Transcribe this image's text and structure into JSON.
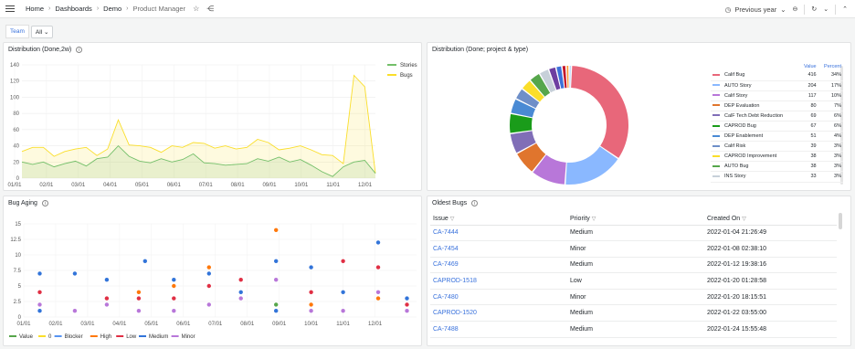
{
  "breadcrumb": [
    "Home",
    "Dashboards",
    "Demo",
    "Product Manager"
  ],
  "time_range": "Previous year",
  "variable": {
    "label": "Team",
    "value": "All"
  },
  "panels": {
    "dist": "Distribution (Done,2w)",
    "donut": "Distribution (Done; project & type)",
    "aging": "Bug Aging",
    "oldest": "Oldest Bugs"
  },
  "icons": [
    "menu-icon",
    "star-icon",
    "share-icon",
    "clock-icon",
    "chevron-down-icon",
    "zoom-out-icon",
    "refresh-icon",
    "chevron-down-icon",
    "info-icon",
    "filter-icon"
  ],
  "colors": {
    "stories": "#73bf69",
    "bugs": "#fade2a",
    "link": "#3871dc"
  },
  "chart_data": [
    {
      "type": "area",
      "title": "Distribution (Done,2w)",
      "x_ticks": [
        "01/01",
        "02/01",
        "03/01",
        "04/01",
        "05/01",
        "06/01",
        "07/01",
        "08/01",
        "09/01",
        "10/01",
        "11/01",
        "12/01"
      ],
      "ylim": [
        0,
        140
      ],
      "y_ticks": [
        0,
        20,
        40,
        60,
        80,
        100,
        120,
        140
      ],
      "legend": "top-right",
      "series": [
        {
          "name": "Stories",
          "color": "#73bf69",
          "values": [
            20,
            17,
            20,
            14,
            18,
            21,
            15,
            24,
            26,
            40,
            27,
            21,
            19,
            24,
            20,
            23,
            30,
            19,
            18,
            16,
            17,
            18,
            24,
            21,
            26,
            20,
            23,
            16,
            8,
            2,
            14,
            20,
            22,
            6
          ]
        },
        {
          "name": "Bugs",
          "color": "#fade2a",
          "values": [
            33,
            38,
            38,
            27,
            33,
            36,
            38,
            28,
            36,
            72,
            41,
            40,
            38,
            32,
            40,
            38,
            44,
            43,
            37,
            40,
            36,
            38,
            48,
            44,
            35,
            37,
            40,
            35,
            29,
            28,
            18,
            127,
            113,
            6
          ]
        }
      ]
    },
    {
      "type": "pie",
      "title": "Distribution (Done; project & type)",
      "columns": [
        "Value",
        "Percent"
      ],
      "slices": [
        {
          "label": "Calif Bug",
          "value": 416,
          "percent": "34%",
          "color": "#e8677a"
        },
        {
          "label": "AUTO Story",
          "value": 204,
          "percent": "17%",
          "color": "#8ab8ff"
        },
        {
          "label": "Calif Story",
          "value": 117,
          "percent": "10%",
          "color": "#b877d9"
        },
        {
          "label": "DEP Evaluation",
          "value": 80,
          "percent": "7%",
          "color": "#e0752d"
        },
        {
          "label": "CalF Tech Debt Reduction",
          "value": 69,
          "percent": "6%",
          "color": "#806eb7"
        },
        {
          "label": "CAPROD Bug",
          "value": 67,
          "percent": "6%",
          "color": "#1a9c1a"
        },
        {
          "label": "DEP Enablement",
          "value": 51,
          "percent": "4%",
          "color": "#4a8ad4"
        },
        {
          "label": "Calif Risk",
          "value": 39,
          "percent": "3%",
          "color": "#6e8fc8"
        },
        {
          "label": "CAPROD Improvement",
          "value": 38,
          "percent": "3%",
          "color": "#fade2a"
        },
        {
          "label": "AUTO Bug",
          "value": 38,
          "percent": "3%",
          "color": "#56a64b"
        },
        {
          "label": "INS Story",
          "value": 33,
          "percent": "3%",
          "color": "#c7d0d9"
        }
      ],
      "extra_slices": [
        {
          "value": 25,
          "color": "#6e3fa0"
        },
        {
          "value": 20,
          "color": "#3d71d9"
        },
        {
          "value": 14,
          "color": "#c4162a"
        },
        {
          "value": 10,
          "color": "#ff9830"
        },
        {
          "value": 8,
          "color": "#a8d0ff"
        }
      ]
    },
    {
      "type": "scatter",
      "title": "Bug Aging",
      "x_ticks": [
        "01/01",
        "02/01",
        "03/01",
        "04/01",
        "05/01",
        "06/01",
        "07/01",
        "08/01",
        "09/01",
        "10/01",
        "11/01",
        "12/01"
      ],
      "ylim": [
        0,
        15
      ],
      "y_ticks": [
        0,
        2.5,
        5,
        7.5,
        10,
        12.5,
        15
      ],
      "legend": "bottom",
      "legend_items": [
        {
          "name": "Value",
          "color": "#56a64b"
        },
        {
          "name": "0",
          "color": "#fade2a"
        },
        {
          "name": "Blocker",
          "color": "#5794f2"
        },
        {
          "name": "High",
          "color": "#ff780a"
        },
        {
          "name": "Low",
          "color": "#e02f44"
        },
        {
          "name": "Medium",
          "color": "#3274d9"
        },
        {
          "name": "Minor",
          "color": "#b877d9"
        }
      ],
      "points": [
        {
          "x": 0.5,
          "y": 7,
          "c": "#3274d9"
        },
        {
          "x": 0.5,
          "y": 4,
          "c": "#e02f44"
        },
        {
          "x": 0.5,
          "y": 2,
          "c": "#b877d9"
        },
        {
          "x": 0.5,
          "y": 1,
          "c": "#3274d9"
        },
        {
          "x": 1.6,
          "y": 7,
          "c": "#3274d9"
        },
        {
          "x": 1.6,
          "y": 1,
          "c": "#b877d9"
        },
        {
          "x": 2.6,
          "y": 6,
          "c": "#3274d9"
        },
        {
          "x": 2.6,
          "y": 3,
          "c": "#e02f44"
        },
        {
          "x": 2.6,
          "y": 2,
          "c": "#b877d9"
        },
        {
          "x": 3.6,
          "y": 4,
          "c": "#ff780a"
        },
        {
          "x": 3.6,
          "y": 3,
          "c": "#e02f44"
        },
        {
          "x": 3.6,
          "y": 1,
          "c": "#b877d9"
        },
        {
          "x": 3.8,
          "y": 9,
          "c": "#3274d9"
        },
        {
          "x": 4.7,
          "y": 6,
          "c": "#3274d9"
        },
        {
          "x": 4.7,
          "y": 5,
          "c": "#ff780a"
        },
        {
          "x": 4.7,
          "y": 3,
          "c": "#e02f44"
        },
        {
          "x": 4.7,
          "y": 1,
          "c": "#b877d9"
        },
        {
          "x": 5.8,
          "y": 8,
          "c": "#ff780a"
        },
        {
          "x": 5.8,
          "y": 7,
          "c": "#3274d9"
        },
        {
          "x": 5.8,
          "y": 5,
          "c": "#e02f44"
        },
        {
          "x": 5.8,
          "y": 2,
          "c": "#b877d9"
        },
        {
          "x": 6.8,
          "y": 6,
          "c": "#e02f44"
        },
        {
          "x": 6.8,
          "y": 4,
          "c": "#3274d9"
        },
        {
          "x": 6.8,
          "y": 3,
          "c": "#b877d9"
        },
        {
          "x": 7.9,
          "y": 14,
          "c": "#ff780a"
        },
        {
          "x": 7.9,
          "y": 9,
          "c": "#3274d9"
        },
        {
          "x": 7.9,
          "y": 6,
          "c": "#b877d9"
        },
        {
          "x": 7.9,
          "y": 2,
          "c": "#56a64b"
        },
        {
          "x": 7.9,
          "y": 1,
          "c": "#3274d9"
        },
        {
          "x": 9.0,
          "y": 8,
          "c": "#3274d9"
        },
        {
          "x": 9.0,
          "y": 4,
          "c": "#e02f44"
        },
        {
          "x": 9.0,
          "y": 2,
          "c": "#ff780a"
        },
        {
          "x": 9.0,
          "y": 1,
          "c": "#b877d9"
        },
        {
          "x": 10.0,
          "y": 9,
          "c": "#e02f44"
        },
        {
          "x": 10.0,
          "y": 4,
          "c": "#3274d9"
        },
        {
          "x": 10.0,
          "y": 1,
          "c": "#b877d9"
        },
        {
          "x": 11.1,
          "y": 12,
          "c": "#3274d9"
        },
        {
          "x": 11.1,
          "y": 8,
          "c": "#e02f44"
        },
        {
          "x": 11.1,
          "y": 4,
          "c": "#b877d9"
        },
        {
          "x": 11.1,
          "y": 3,
          "c": "#ff780a"
        },
        {
          "x": 12.0,
          "y": 3,
          "c": "#3274d9"
        },
        {
          "x": 12.0,
          "y": 2,
          "c": "#e02f44"
        },
        {
          "x": 12.0,
          "y": 1,
          "c": "#b877d9"
        }
      ]
    }
  ],
  "oldest_bugs": {
    "headers": [
      "Issue",
      "Priority",
      "Created On"
    ],
    "rows": [
      [
        "CA-7444",
        "Medium",
        "2022-01-04 21:26:49"
      ],
      [
        "CA-7454",
        "Minor",
        "2022-01-08 02:38:10"
      ],
      [
        "CA-7469",
        "Medium",
        "2022-01-12 19:38:16"
      ],
      [
        "CAPROD-1518",
        "Low",
        "2022-01-20 01:28:58"
      ],
      [
        "CA-7480",
        "Minor",
        "2022-01-20 18:15:51"
      ],
      [
        "CAPROD-1520",
        "Medium",
        "2022-01-22 03:55:00"
      ],
      [
        "CA-7488",
        "Medium",
        "2022-01-24 15:55:48"
      ]
    ]
  }
}
